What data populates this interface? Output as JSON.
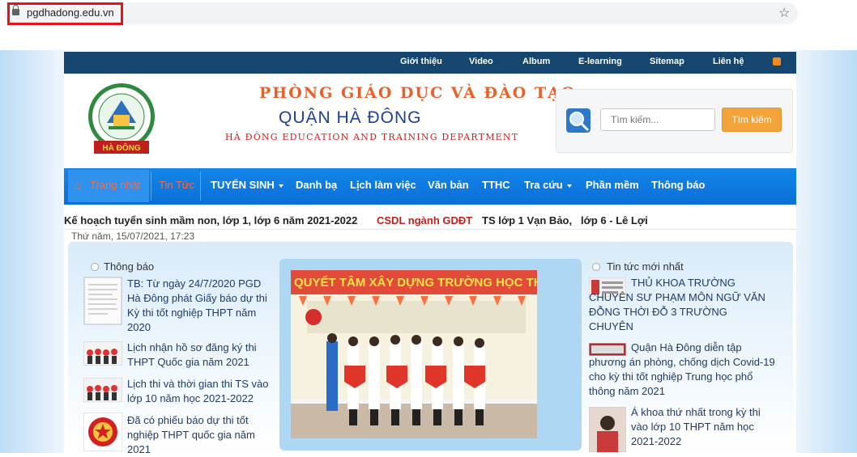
{
  "browser": {
    "url": "pgdhadong.edu.vn"
  },
  "topnav": {
    "items": [
      "Giới thiệu",
      "Video",
      "Album",
      "E-learning",
      "Sitemap",
      "Liên hệ"
    ]
  },
  "header": {
    "title_line1": "PHÒNG GIÁO DỤC VÀ ĐÀO TẠO",
    "title_line2": "QUẬN HÀ ĐÔNG",
    "title_line3": "HÀ ĐÔNG EDUCATION AND TRAINING DEPARTMENT",
    "logo_text_top": "PHÒNG GIÁO DỤC VÀ ĐÀO TẠO",
    "logo_text_bottom": "HÀ ĐÔNG"
  },
  "search": {
    "placeholder": "Tìm kiếm...",
    "button": "Tìm kiếm"
  },
  "mainnav": {
    "items": [
      "Trang nhất",
      "Tin Tức",
      "TUYỂN SINH",
      "Danh bạ",
      "Lịch làm việc",
      "Văn bản",
      "TTHC",
      "Tra cứu",
      "Phần mềm",
      "Thông báo"
    ]
  },
  "ticker": {
    "item1": "Kế hoạch tuyển sinh mầm non, lớp 1, lớp 6 năm 2021-2022",
    "item2": "CSDL ngành GDĐT",
    "item3": "TS lớp 1 Vạn Bảo,",
    "item4": "lớp 6 - Lê Lợi"
  },
  "date": "Thứ năm, 15/07/2021, 17:23",
  "announcements": {
    "title": "Thông báo",
    "items": [
      "TB: Từ ngày 24/7/2020 PGD Hà Đông phát Giấy báo dự thi Kỳ thi tốt nghiệp THPT năm 2020",
      "Lịch nhận hồ sơ đăng ký thi THPT Quốc gia năm 2021",
      "Lịch thi và thời gian thi TS vào lớp 10 năm học 2021-2022",
      "Đã có phiếu báo dự thi tốt nghiệp THPT quốc gia năm 2021"
    ]
  },
  "photo": {
    "banner": "QUYẾT TÂM XÂY DỰNG TRƯỜNG HỌC THÂN TH"
  },
  "news": {
    "title": "Tin tức mới nhất",
    "items": [
      "THỦ KHOA TRƯỜNG CHUYÊN SƯ PHẠM MÔN NGỮ VĂN ĐỖNG THỜI ĐỖ 3 TRƯỜNG CHUYÊN",
      "Quận Hà Đông diễn tập phương án phòng, chống dịch Covid-19 cho kỳ thi tốt nghiệp Trung học phổ thông năm 2021",
      "Á khoa thứ nhất trong kỳ thi vào lớp 10 THPT năm học 2021-2022"
    ]
  }
}
